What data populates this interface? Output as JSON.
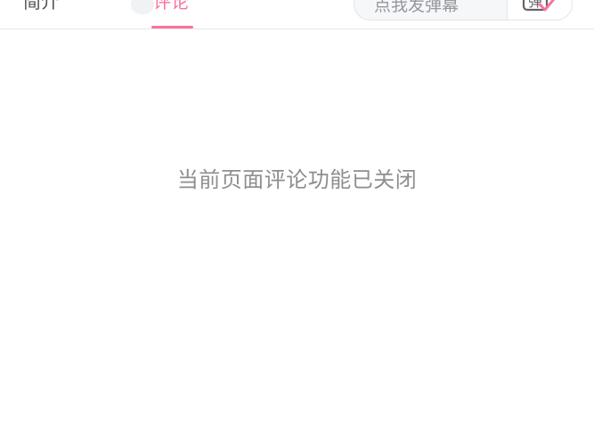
{
  "tabs": {
    "intro_label": "简介",
    "comments_label": "评论"
  },
  "danmaku": {
    "placeholder": "点我发弹幕",
    "toggle_icon": "danmaku-toggle-icon",
    "toggle_icon_glyph": "弹"
  },
  "comments": {
    "closed_message": "当前页面评论功能已关闭"
  },
  "colors": {
    "accent": "#fb7299",
    "text_primary": "#505050",
    "text_muted": "#8e8e8e",
    "divider": "#e7e7e7"
  }
}
